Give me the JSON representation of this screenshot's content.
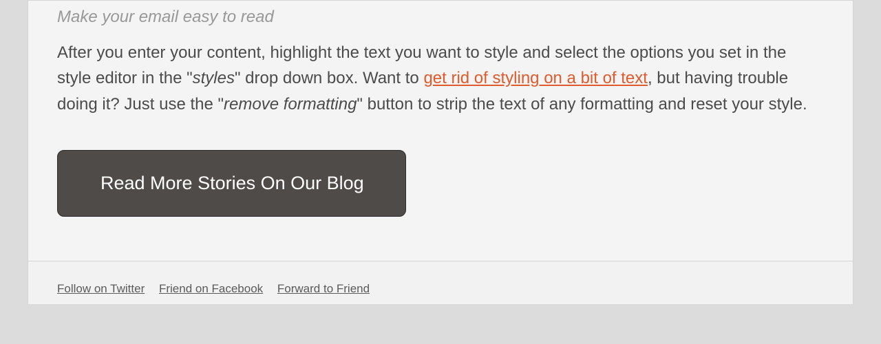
{
  "subheading": "Make your email easy to read",
  "paragraph": {
    "p1": "After you enter your content, highlight the text you want to style and select the options you set in the style editor in the \"",
    "em1": "styles",
    "p2": "\" drop down box. Want to ",
    "link": "get rid of styling on a bit of text",
    "p3": ", but having trouble doing it? Just use the \"",
    "em2": "remove formatting",
    "p4": "\" button to strip the text of any formatting and reset your style."
  },
  "cta_label": "Read More Stories On Our Blog",
  "footer": {
    "twitter": "Follow on Twitter",
    "facebook": "Friend on Facebook",
    "forward": "Forward to Friend"
  }
}
